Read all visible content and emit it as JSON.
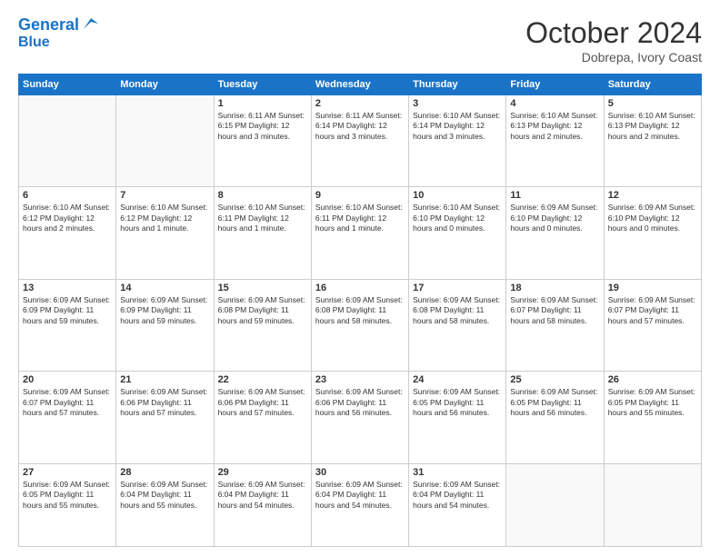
{
  "header": {
    "logo_line1": "General",
    "logo_line2": "Blue",
    "month": "October 2024",
    "location": "Dobrepa, Ivory Coast"
  },
  "weekdays": [
    "Sunday",
    "Monday",
    "Tuesday",
    "Wednesday",
    "Thursday",
    "Friday",
    "Saturday"
  ],
  "weeks": [
    [
      {
        "day": "",
        "info": ""
      },
      {
        "day": "",
        "info": ""
      },
      {
        "day": "1",
        "info": "Sunrise: 6:11 AM\nSunset: 6:15 PM\nDaylight: 12 hours\nand 3 minutes."
      },
      {
        "day": "2",
        "info": "Sunrise: 6:11 AM\nSunset: 6:14 PM\nDaylight: 12 hours\nand 3 minutes."
      },
      {
        "day": "3",
        "info": "Sunrise: 6:10 AM\nSunset: 6:14 PM\nDaylight: 12 hours\nand 3 minutes."
      },
      {
        "day": "4",
        "info": "Sunrise: 6:10 AM\nSunset: 6:13 PM\nDaylight: 12 hours\nand 2 minutes."
      },
      {
        "day": "5",
        "info": "Sunrise: 6:10 AM\nSunset: 6:13 PM\nDaylight: 12 hours\nand 2 minutes."
      }
    ],
    [
      {
        "day": "6",
        "info": "Sunrise: 6:10 AM\nSunset: 6:12 PM\nDaylight: 12 hours\nand 2 minutes."
      },
      {
        "day": "7",
        "info": "Sunrise: 6:10 AM\nSunset: 6:12 PM\nDaylight: 12 hours\nand 1 minute."
      },
      {
        "day": "8",
        "info": "Sunrise: 6:10 AM\nSunset: 6:11 PM\nDaylight: 12 hours\nand 1 minute."
      },
      {
        "day": "9",
        "info": "Sunrise: 6:10 AM\nSunset: 6:11 PM\nDaylight: 12 hours\nand 1 minute."
      },
      {
        "day": "10",
        "info": "Sunrise: 6:10 AM\nSunset: 6:10 PM\nDaylight: 12 hours\nand 0 minutes."
      },
      {
        "day": "11",
        "info": "Sunrise: 6:09 AM\nSunset: 6:10 PM\nDaylight: 12 hours\nand 0 minutes."
      },
      {
        "day": "12",
        "info": "Sunrise: 6:09 AM\nSunset: 6:10 PM\nDaylight: 12 hours\nand 0 minutes."
      }
    ],
    [
      {
        "day": "13",
        "info": "Sunrise: 6:09 AM\nSunset: 6:09 PM\nDaylight: 11 hours\nand 59 minutes."
      },
      {
        "day": "14",
        "info": "Sunrise: 6:09 AM\nSunset: 6:09 PM\nDaylight: 11 hours\nand 59 minutes."
      },
      {
        "day": "15",
        "info": "Sunrise: 6:09 AM\nSunset: 6:08 PM\nDaylight: 11 hours\nand 59 minutes."
      },
      {
        "day": "16",
        "info": "Sunrise: 6:09 AM\nSunset: 6:08 PM\nDaylight: 11 hours\nand 58 minutes."
      },
      {
        "day": "17",
        "info": "Sunrise: 6:09 AM\nSunset: 6:08 PM\nDaylight: 11 hours\nand 58 minutes."
      },
      {
        "day": "18",
        "info": "Sunrise: 6:09 AM\nSunset: 6:07 PM\nDaylight: 11 hours\nand 58 minutes."
      },
      {
        "day": "19",
        "info": "Sunrise: 6:09 AM\nSunset: 6:07 PM\nDaylight: 11 hours\nand 57 minutes."
      }
    ],
    [
      {
        "day": "20",
        "info": "Sunrise: 6:09 AM\nSunset: 6:07 PM\nDaylight: 11 hours\nand 57 minutes."
      },
      {
        "day": "21",
        "info": "Sunrise: 6:09 AM\nSunset: 6:06 PM\nDaylight: 11 hours\nand 57 minutes."
      },
      {
        "day": "22",
        "info": "Sunrise: 6:09 AM\nSunset: 6:06 PM\nDaylight: 11 hours\nand 57 minutes."
      },
      {
        "day": "23",
        "info": "Sunrise: 6:09 AM\nSunset: 6:06 PM\nDaylight: 11 hours\nand 56 minutes."
      },
      {
        "day": "24",
        "info": "Sunrise: 6:09 AM\nSunset: 6:05 PM\nDaylight: 11 hours\nand 56 minutes."
      },
      {
        "day": "25",
        "info": "Sunrise: 6:09 AM\nSunset: 6:05 PM\nDaylight: 11 hours\nand 56 minutes."
      },
      {
        "day": "26",
        "info": "Sunrise: 6:09 AM\nSunset: 6:05 PM\nDaylight: 11 hours\nand 55 minutes."
      }
    ],
    [
      {
        "day": "27",
        "info": "Sunrise: 6:09 AM\nSunset: 6:05 PM\nDaylight: 11 hours\nand 55 minutes."
      },
      {
        "day": "28",
        "info": "Sunrise: 6:09 AM\nSunset: 6:04 PM\nDaylight: 11 hours\nand 55 minutes."
      },
      {
        "day": "29",
        "info": "Sunrise: 6:09 AM\nSunset: 6:04 PM\nDaylight: 11 hours\nand 54 minutes."
      },
      {
        "day": "30",
        "info": "Sunrise: 6:09 AM\nSunset: 6:04 PM\nDaylight: 11 hours\nand 54 minutes."
      },
      {
        "day": "31",
        "info": "Sunrise: 6:09 AM\nSunset: 6:04 PM\nDaylight: 11 hours\nand 54 minutes."
      },
      {
        "day": "",
        "info": ""
      },
      {
        "day": "",
        "info": ""
      }
    ]
  ]
}
